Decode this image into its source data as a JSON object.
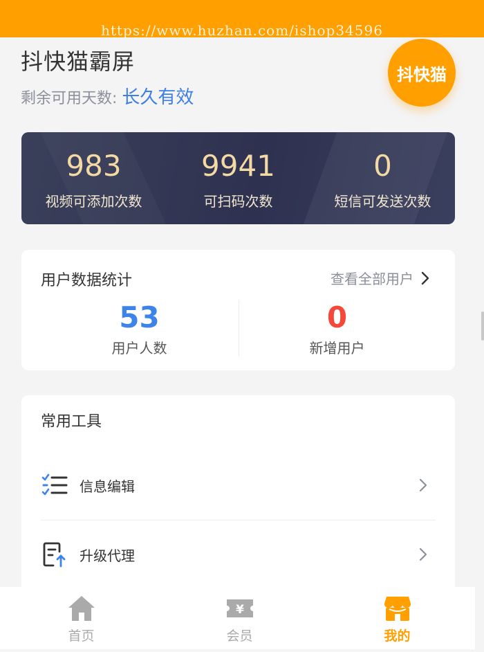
{
  "watermark": "https://www.huzhan.com/ishop34596",
  "header": {
    "title": "抖快猫霸屏",
    "validity_label": "剩余可用天数:",
    "validity_value": "长久有效",
    "badge": "抖快猫"
  },
  "stats": [
    {
      "value": "983",
      "label": "视频可添加次数"
    },
    {
      "value": "9941",
      "label": "可扫码次数"
    },
    {
      "value": "0",
      "label": "短信可发送次数"
    }
  ],
  "user_stats": {
    "title": "用户数据统计",
    "view_all": "查看全部用户",
    "items": [
      {
        "value": "53",
        "label": "用户人数",
        "color": "#3d84e8"
      },
      {
        "value": "0",
        "label": "新增用户",
        "color": "#f5483b"
      }
    ]
  },
  "tools": {
    "title": "常用工具",
    "items": [
      {
        "label": "信息编辑",
        "icon": "list-check-icon"
      },
      {
        "label": "升级代理",
        "icon": "upgrade-doc-icon"
      }
    ]
  },
  "nav": {
    "items": [
      {
        "label": "首页",
        "icon": "home-icon",
        "active": false
      },
      {
        "label": "会员",
        "icon": "member-ticket-icon",
        "active": false
      },
      {
        "label": "我的",
        "icon": "shop-icon",
        "active": true
      }
    ]
  },
  "colors": {
    "accent": "#ff9f00",
    "link_blue": "#3d7fe6",
    "stat_gold": "#f3d9a4",
    "card_dark": "#2e3250"
  }
}
